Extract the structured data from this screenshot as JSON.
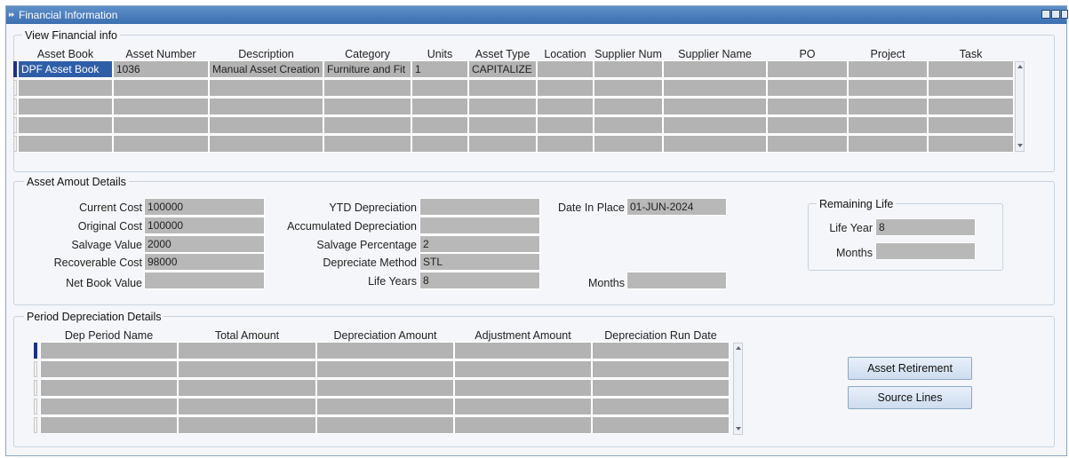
{
  "window": {
    "title": "Financial Information"
  },
  "view_financial": {
    "legend": "View Financial info",
    "columns": [
      "Asset Book",
      "Asset Number",
      "Description",
      "Category",
      "Units",
      "Asset Type",
      "Location",
      "Supplier Num",
      "Supplier Name",
      "PO",
      "Project",
      "Task"
    ],
    "rows": [
      [
        "DPF Asset Book",
        "1036",
        "Manual Asset Creation",
        "Furniture and Fit",
        "1",
        "CAPITALIZE",
        "",
        "",
        "",
        "",
        "",
        ""
      ],
      [
        "",
        "",
        "",
        "",
        "",
        "",
        "",
        "",
        "",
        "",
        "",
        ""
      ],
      [
        "",
        "",
        "",
        "",
        "",
        "",
        "",
        "",
        "",
        "",
        "",
        ""
      ],
      [
        "",
        "",
        "",
        "",
        "",
        "",
        "",
        "",
        "",
        "",
        "",
        ""
      ],
      [
        "",
        "",
        "",
        "",
        "",
        "",
        "",
        "",
        "",
        "",
        "",
        ""
      ]
    ]
  },
  "asset_amount": {
    "legend": "Asset Amout Details",
    "current_cost_label": "Current  Cost",
    "current_cost": "100000",
    "original_cost_label": "Original Cost",
    "original_cost": "100000",
    "salvage_value_label": "Salvage Value",
    "salvage_value": "2000",
    "recoverable_cost_label": "Recoverable Cost",
    "recoverable_cost": "98000",
    "net_book_value_label": "Net Book Value",
    "net_book_value": "",
    "ytd_depreciation_label": "YTD Depreciation",
    "ytd_depreciation": "",
    "accumulated_depreciation_label": "Accumulated Depreciation",
    "accumulated_depreciation": "",
    "salvage_percentage_label": "Salvage Percentage",
    "salvage_percentage": "2",
    "depreciate_method_label": "Depreciate Method",
    "depreciate_method": "STL",
    "life_years_label": "Life Years",
    "life_years": "8",
    "date_in_place_label": "Date In Place",
    "date_in_place": "01-JUN-2024",
    "months_label": "Months",
    "months": ""
  },
  "remaining_life": {
    "legend": "Remaining Life",
    "life_year_label": "Life Year",
    "life_year": "8",
    "months_label": "Months",
    "months": ""
  },
  "period_depreciation": {
    "legend": "Period Depreciation Details",
    "columns": [
      "Dep Period Name",
      "Total Amount",
      "Depreciation Amount",
      "Adjustment Amount",
      "Depreciation Run Date"
    ],
    "rows": [
      [
        "",
        "",
        "",
        "",
        ""
      ],
      [
        "",
        "",
        "",
        "",
        ""
      ],
      [
        "",
        "",
        "",
        "",
        ""
      ],
      [
        "",
        "",
        "",
        "",
        ""
      ],
      [
        "",
        "",
        "",
        "",
        ""
      ]
    ]
  },
  "buttons": {
    "asset_retirement": "Asset Retirement",
    "source_lines": "Source Lines"
  },
  "colors": {
    "titlebar": "#3b6fb0",
    "field": "#b8b8b8",
    "selected": "#2f5ea8"
  }
}
